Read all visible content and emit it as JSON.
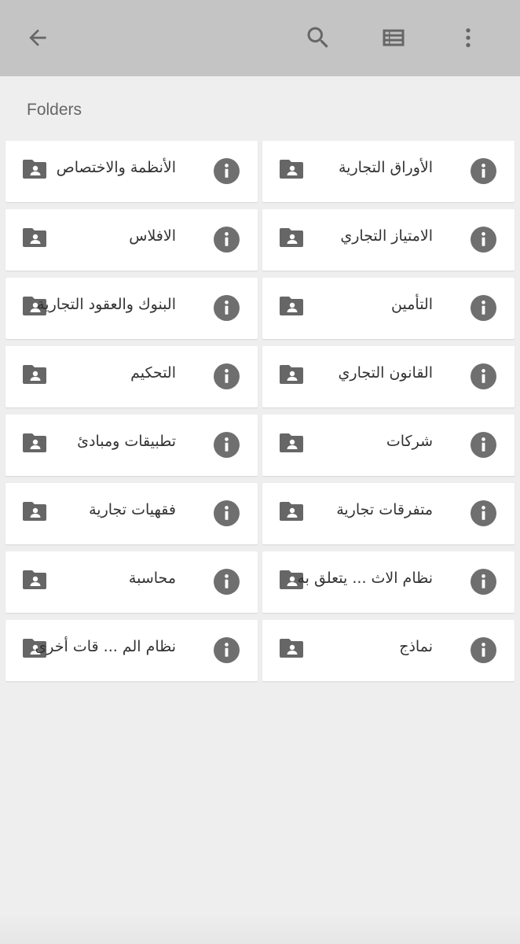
{
  "app_bar": {
    "background": "#c4c4c4",
    "icons": {
      "back": "arrow-back-icon",
      "search": "search-icon",
      "list": "list-view-icon",
      "more": "more-vert-icon"
    }
  },
  "section": {
    "title": "Folders"
  },
  "folders": [
    {
      "label": "الأوراق التجارية"
    },
    {
      "label": "الأنظمة والاختصاص"
    },
    {
      "label": "الامتياز التجاري"
    },
    {
      "label": "الافلاس"
    },
    {
      "label": "التأمين"
    },
    {
      "label": "البنوك والعقود التجارية"
    },
    {
      "label": "القانون التجاري"
    },
    {
      "label": "التحكيم"
    },
    {
      "label": "شركات"
    },
    {
      "label": "تطبيقات ومبادئ"
    },
    {
      "label": "متفرقات تجارية"
    },
    {
      "label": "فقهيات تجارية"
    },
    {
      "label": "نظام الاث ... يتعلق به"
    },
    {
      "label": "محاسبة"
    },
    {
      "label": "نماذج"
    },
    {
      "label": "نظام الم ... قات أخرى"
    }
  ],
  "colors": {
    "icon_gray": "#666666",
    "info_gray": "#6f6f6f",
    "card_bg": "#ffffff",
    "page_bg": "#eeeeee"
  }
}
